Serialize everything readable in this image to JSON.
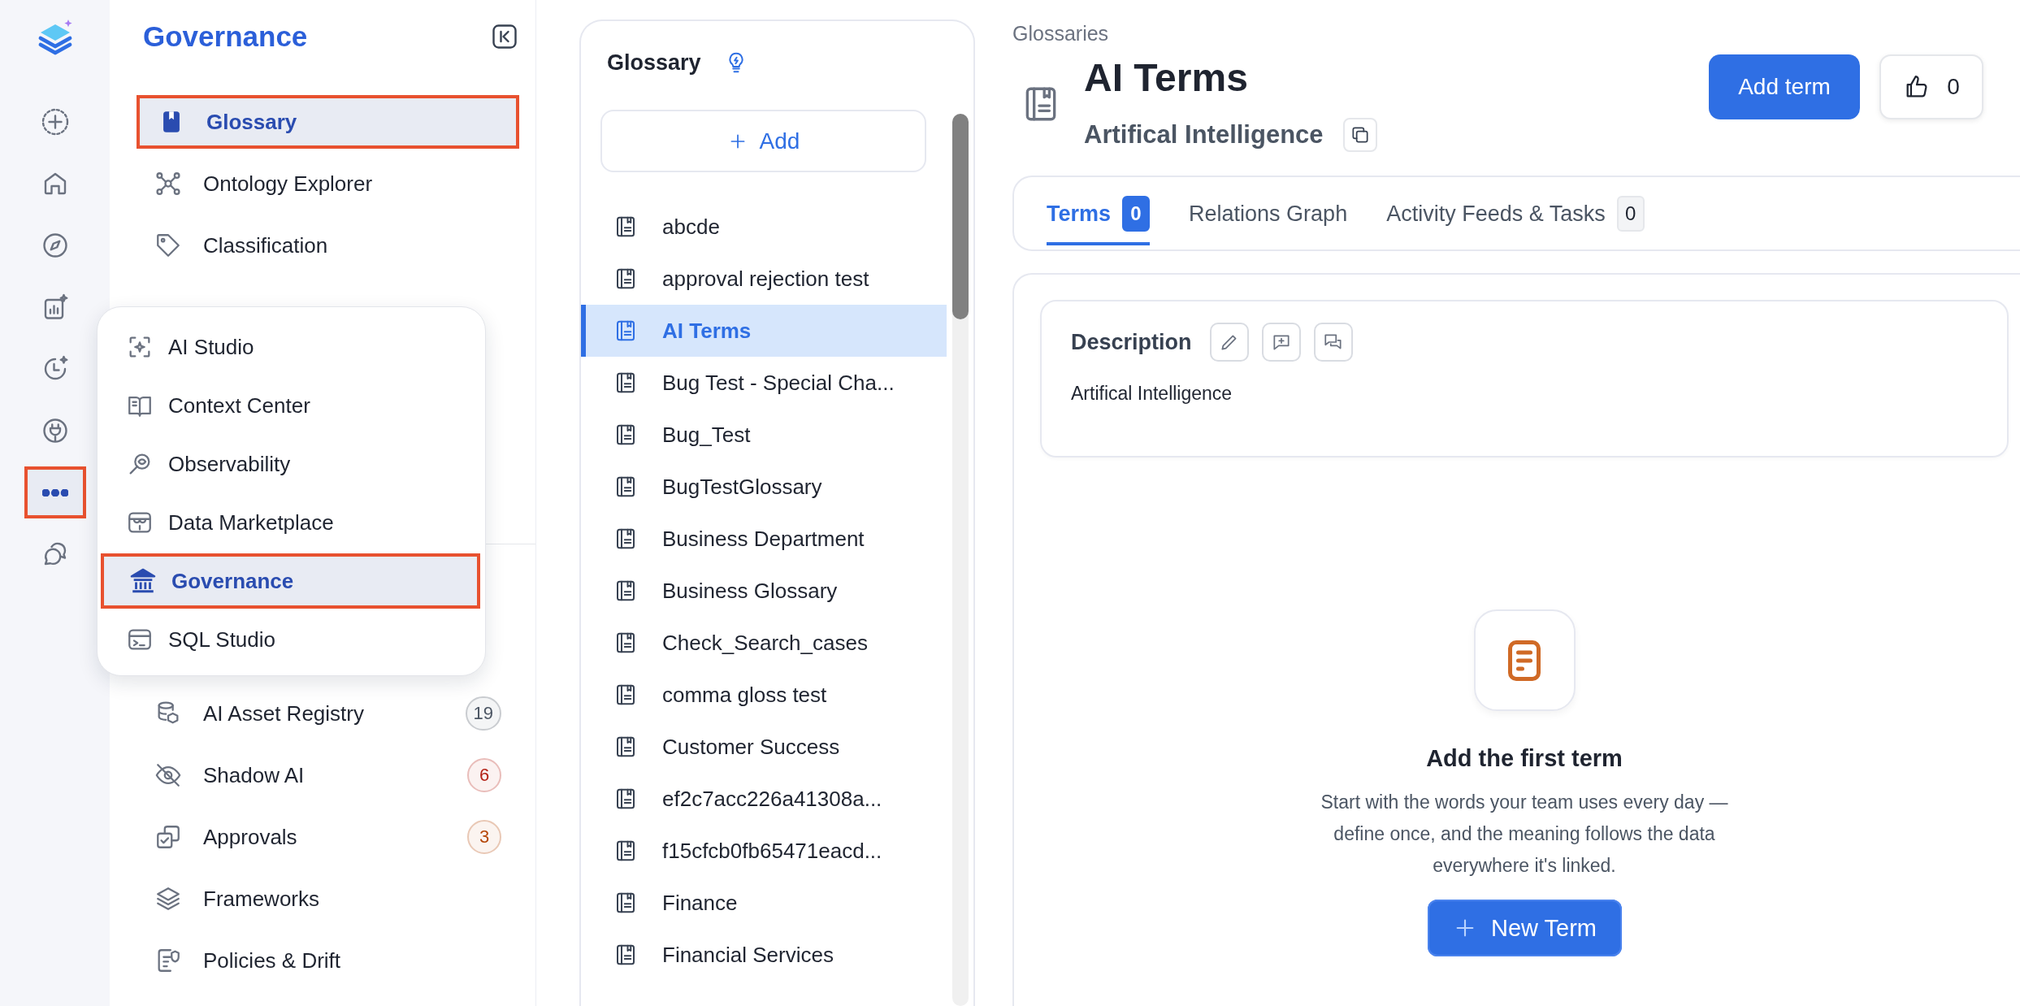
{
  "rail": {
    "items": [
      {
        "selected": false,
        "highlighted": false
      },
      {
        "selected": false,
        "highlighted": false
      },
      {
        "selected": false,
        "highlighted": false
      },
      {
        "selected": false,
        "highlighted": false
      },
      {
        "selected": false,
        "highlighted": false
      },
      {
        "selected": false,
        "highlighted": false
      },
      {
        "selected": true,
        "highlighted": true
      },
      {
        "selected": false,
        "highlighted": false
      }
    ]
  },
  "sidebar": {
    "title": "Governance",
    "groups": [
      {
        "items": [
          {
            "label": "Glossary",
            "selected": true,
            "highlighted": true
          },
          {
            "label": "Ontology Explorer",
            "selected": false,
            "highlighted": false
          },
          {
            "label": "Classification",
            "selected": false,
            "highlighted": false
          }
        ]
      },
      {
        "items": [
          {
            "label": "AI Asset Registry",
            "selected": false,
            "highlighted": false,
            "badge": {
              "text": "19",
              "color": "#4b5563"
            }
          },
          {
            "label": "Shadow AI",
            "selected": false,
            "highlighted": false,
            "badge": {
              "text": "6",
              "color": "#b42318"
            }
          },
          {
            "label": "Approvals",
            "selected": false,
            "highlighted": false,
            "badge": {
              "text": "3",
              "color": "#b54708"
            }
          },
          {
            "label": "Frameworks",
            "selected": false,
            "highlighted": false
          },
          {
            "label": "Policies & Drift",
            "selected": false,
            "highlighted": false
          }
        ]
      }
    ]
  },
  "more_menu": {
    "items": [
      {
        "label": "AI Studio",
        "selected": false,
        "highlighted": false
      },
      {
        "label": "Context Center",
        "selected": false,
        "highlighted": false
      },
      {
        "label": "Observability",
        "selected": false,
        "highlighted": false
      },
      {
        "label": "Data Marketplace",
        "selected": false,
        "highlighted": false
      },
      {
        "label": "Governance",
        "selected": true,
        "highlighted": true
      },
      {
        "label": "SQL Studio",
        "selected": false,
        "highlighted": false
      }
    ]
  },
  "glossary_panel": {
    "title": "Glossary",
    "add_button": "Add",
    "items": [
      {
        "label": "abcde",
        "selected": false
      },
      {
        "label": "approval rejection test",
        "selected": false
      },
      {
        "label": "AI Terms",
        "selected": true
      },
      {
        "label": "Bug Test - Special Cha...",
        "selected": false
      },
      {
        "label": "Bug_Test",
        "selected": false
      },
      {
        "label": "BugTestGlossary",
        "selected": false
      },
      {
        "label": "Business Department",
        "selected": false
      },
      {
        "label": "Business Glossary",
        "selected": false
      },
      {
        "label": "Check_Search_cases",
        "selected": false
      },
      {
        "label": "comma gloss test",
        "selected": false
      },
      {
        "label": "Customer Success",
        "selected": false
      },
      {
        "label": "ef2c7acc226a41308a...",
        "selected": false
      },
      {
        "label": "f15cfcb0fb65471eacd...",
        "selected": false
      },
      {
        "label": "Finance",
        "selected": false
      },
      {
        "label": "Financial Services",
        "selected": false
      }
    ]
  },
  "main": {
    "breadcrumb": "Glossaries",
    "title": "AI Terms",
    "subtitle": "Artifical Intelligence",
    "add_term_button": "Add term",
    "likes": "0",
    "tabs": [
      {
        "label": "Terms",
        "badge": "0",
        "selected": true
      },
      {
        "label": "Relations Graph",
        "selected": false
      },
      {
        "label": "Activity Feeds & Tasks",
        "badge": "0",
        "selected": false
      }
    ],
    "description": {
      "title": "Description",
      "text": "Artifical Intelligence"
    },
    "empty_state": {
      "title": "Add the first term",
      "text": "Start with the words your team uses every day — define once, and the meaning follows the data everywhere it's linked.",
      "button": "New Term"
    }
  }
}
